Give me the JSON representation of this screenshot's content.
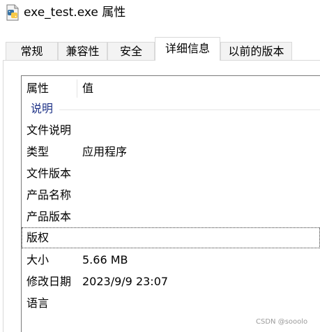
{
  "window": {
    "title": "exe_test.exe 属性",
    "icon": "python-file-icon"
  },
  "tabs": [
    {
      "label": "常规",
      "active": false
    },
    {
      "label": "兼容性",
      "active": false
    },
    {
      "label": "安全",
      "active": false
    },
    {
      "label": "详细信息",
      "active": true
    },
    {
      "label": "以前的版本",
      "active": false
    }
  ],
  "details": {
    "headers": {
      "property": "属性",
      "value": "值"
    },
    "group": "说明",
    "rows": [
      {
        "key": "文件说明",
        "value": ""
      },
      {
        "key": "类型",
        "value": "应用程序"
      },
      {
        "key": "文件版本",
        "value": ""
      },
      {
        "key": "产品名称",
        "value": ""
      },
      {
        "key": "产品版本",
        "value": ""
      },
      {
        "key": "版权",
        "value": ""
      },
      {
        "key": "大小",
        "value": "5.66 MB"
      },
      {
        "key": "修改日期",
        "value": "2023/9/9 23:07"
      },
      {
        "key": "语言",
        "value": ""
      }
    ]
  },
  "watermark": "CSDN @sooolo",
  "colors": {
    "group_label": "#1e3287",
    "tab_inactive_bg": "#f3f3f3",
    "border": "#d9d9d9"
  }
}
